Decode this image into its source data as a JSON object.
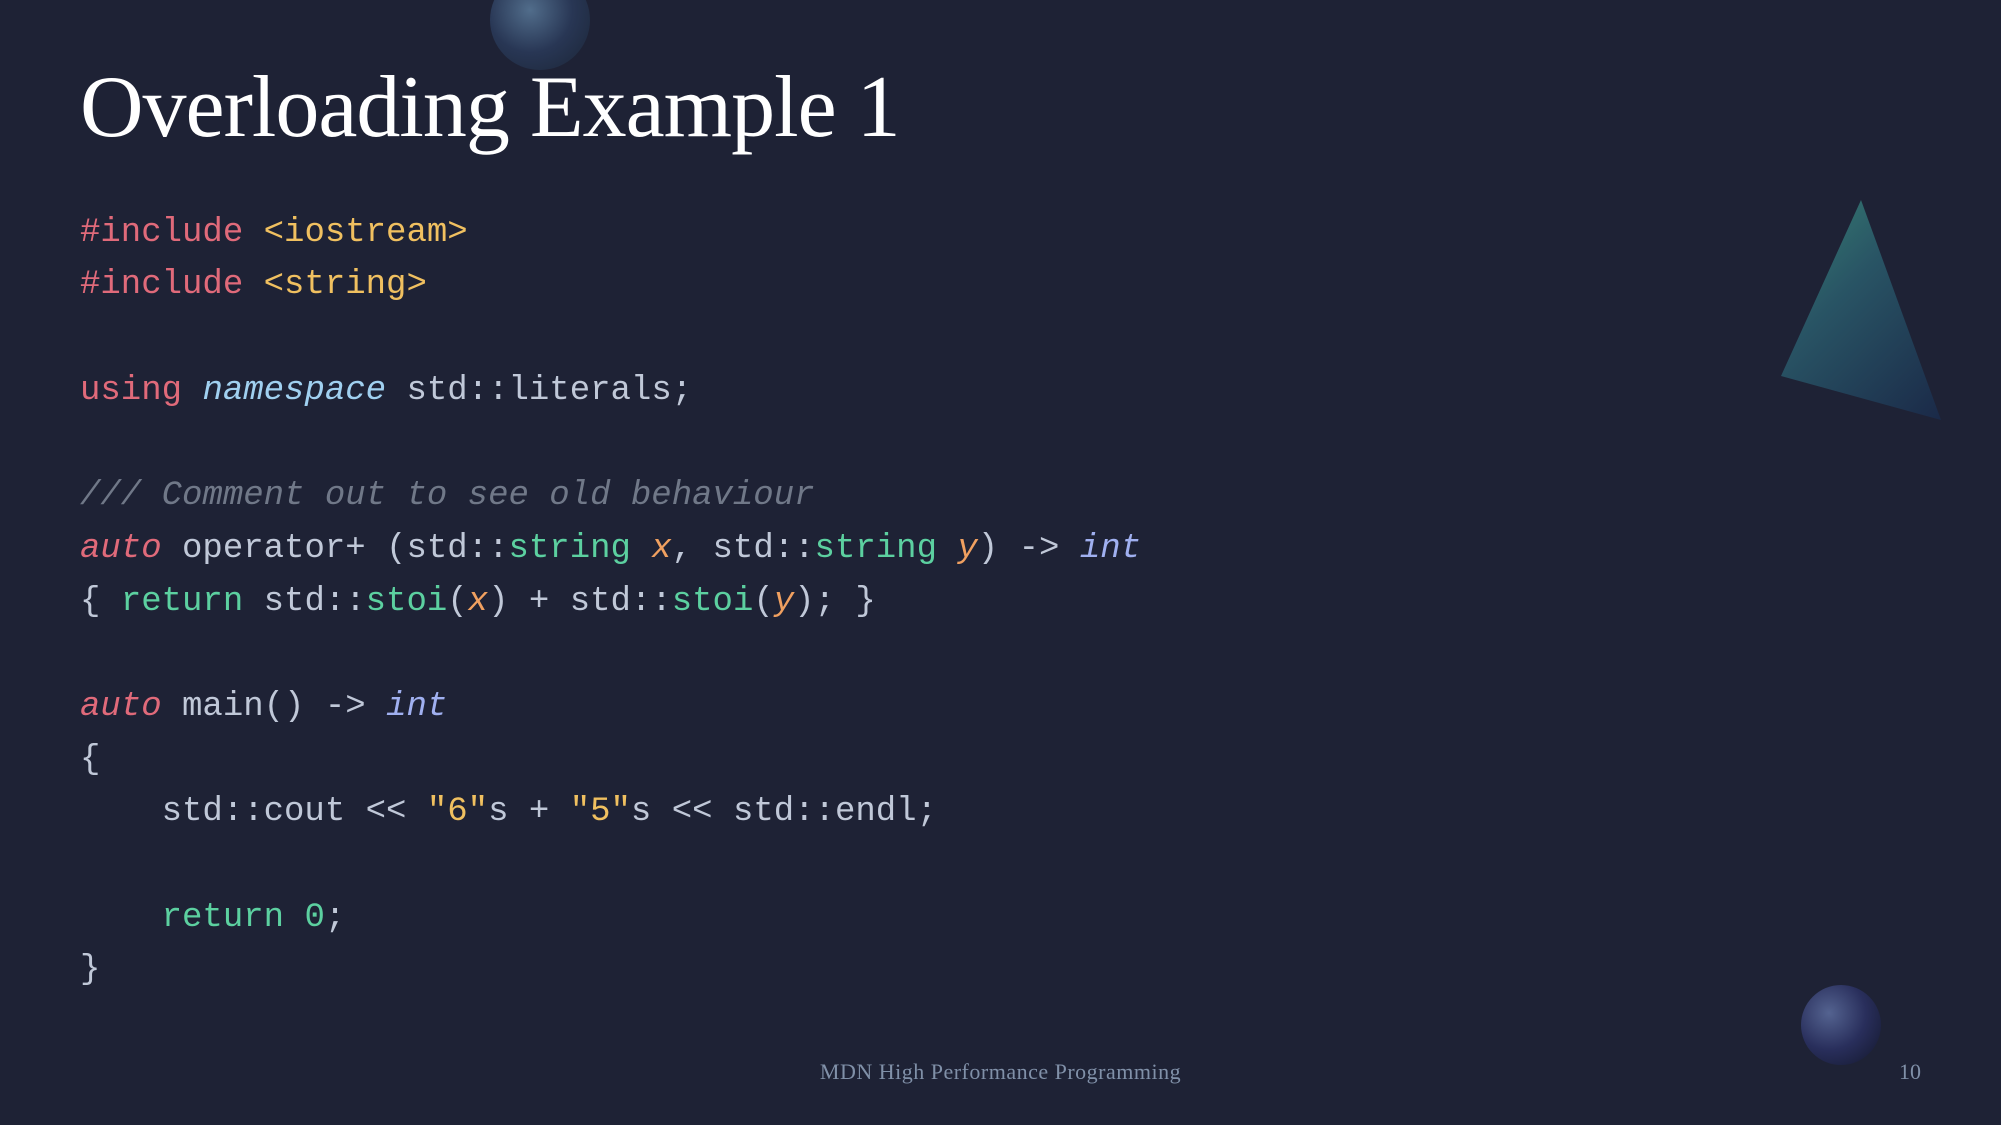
{
  "slide": {
    "title": "Overloading Example 1",
    "footer_title": "MDN High Performance Programming",
    "page_number": "10"
  },
  "code": {
    "lines": [
      {
        "id": "include1",
        "type": "include",
        "preprocessor": "#include",
        "path": " <iostream>"
      },
      {
        "id": "include2",
        "type": "include",
        "preprocessor": "#include",
        "path": " <string>"
      },
      {
        "id": "empty1"
      },
      {
        "id": "using",
        "type": "using"
      },
      {
        "id": "empty2"
      },
      {
        "id": "comment",
        "type": "comment",
        "text": "/// Comment out to see old behaviour"
      },
      {
        "id": "operator",
        "type": "operator_decl"
      },
      {
        "id": "operator_body",
        "type": "operator_body"
      },
      {
        "id": "empty3"
      },
      {
        "id": "main_decl",
        "type": "main_decl"
      },
      {
        "id": "open_brace",
        "type": "brace",
        "text": "{"
      },
      {
        "id": "cout",
        "type": "cout"
      },
      {
        "id": "empty4"
      },
      {
        "id": "return_stmt",
        "type": "return"
      },
      {
        "id": "close_brace",
        "type": "brace",
        "text": "}"
      }
    ]
  },
  "decorations": {
    "orb_top_desc": "teal sphere top center",
    "shape_right_desc": "teal geometric cone top right",
    "orb_bottom_right_desc": "dark blue sphere bottom right"
  }
}
